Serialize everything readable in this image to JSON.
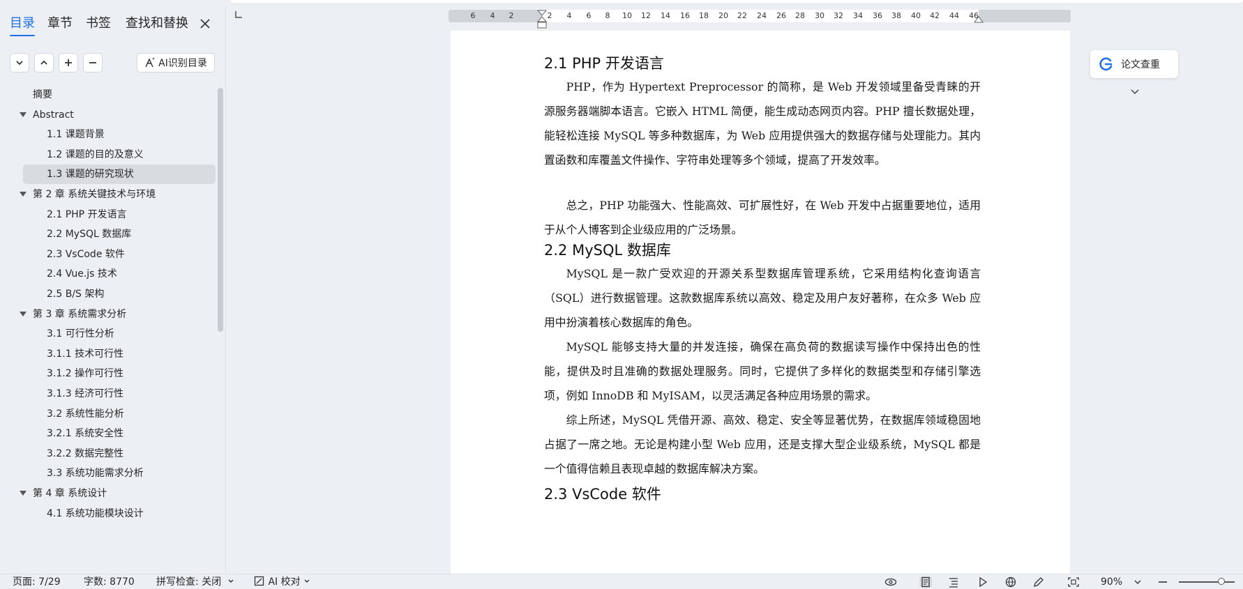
{
  "sidebar": {
    "tabs": [
      "目录",
      "章节",
      "书签",
      "查找和替换"
    ],
    "ai_button": "AI识别目录",
    "toc": [
      {
        "label": "摘要",
        "level": 1,
        "caret": false,
        "selected": false
      },
      {
        "label": "Abstract",
        "level": 1,
        "caret": true,
        "selected": false
      },
      {
        "label": "1.1  课题背景",
        "level": 2,
        "caret": false,
        "selected": false
      },
      {
        "label": "1.2  课题的目的及意义",
        "level": 2,
        "caret": false,
        "selected": false
      },
      {
        "label": "1.3  课题的研究现状",
        "level": 2,
        "caret": false,
        "selected": true
      },
      {
        "label": "第 2 章  系统关键技术与环境",
        "level": 1,
        "caret": true,
        "selected": false
      },
      {
        "label": "2.1 PHP 开发语言",
        "level": 2,
        "caret": false,
        "selected": false
      },
      {
        "label": "2.2 MySQL 数据库",
        "level": 2,
        "caret": false,
        "selected": false
      },
      {
        "label": "2.3 VsCode 软件",
        "level": 2,
        "caret": false,
        "selected": false
      },
      {
        "label": "2.4 Vue.js 技术",
        "level": 2,
        "caret": false,
        "selected": false
      },
      {
        "label": "2.5 B/S 架构",
        "level": 2,
        "caret": false,
        "selected": false
      },
      {
        "label": "第 3 章  系统需求分析",
        "level": 1,
        "caret": true,
        "selected": false
      },
      {
        "label": "3.1 可行性分析",
        "level": 2,
        "caret": false,
        "selected": false
      },
      {
        "label": "3.1.1  技术可行性",
        "level": 2,
        "caret": false,
        "selected": false
      },
      {
        "label": "3.1.2  操作可行性",
        "level": 2,
        "caret": false,
        "selected": false
      },
      {
        "label": "3.1.3  经济可行性",
        "level": 2,
        "caret": false,
        "selected": false
      },
      {
        "label": "3.2 系统性能分析",
        "level": 2,
        "caret": false,
        "selected": false
      },
      {
        "label": "3.2.1  系统安全性",
        "level": 2,
        "caret": false,
        "selected": false
      },
      {
        "label": "3.2.2  数据完整性",
        "level": 2,
        "caret": false,
        "selected": false
      },
      {
        "label": "3.3  系统功能需求分析",
        "level": 2,
        "caret": false,
        "selected": false
      },
      {
        "label": "第 4 章  系统设计",
        "level": 1,
        "caret": true,
        "selected": false
      },
      {
        "label": "4.1 系统功能模块设计",
        "level": 2,
        "caret": false,
        "selected": false
      }
    ]
  },
  "ruler": {
    "ticks": [
      "6",
      "4",
      "2",
      "",
      "2",
      "4",
      "6",
      "8",
      "10",
      "12",
      "14",
      "16",
      "18",
      "20",
      "22",
      "24",
      "26",
      "28",
      "30",
      "32",
      "34",
      "36",
      "38",
      "40",
      "42",
      "44",
      "46"
    ]
  },
  "document": {
    "h_21": "2.1 PHP 开发语言",
    "p_21a": "PHP，作为 Hypertext Preprocessor 的简称，是 Web 开发领域里备受青睐的开源服务器端脚本语言。它嵌入 HTML 简便，能生成动态网页内容。PHP 擅长数据处理，能轻松连接 MySQL 等多种数据库，为 Web 应用提供强大的数据存储与处理能力。其内置函数和库覆盖文件操作、字符串处理等多个领域，提高了开发效率。",
    "p_21b": "总之，PHP 功能强大、性能高效、可扩展性好，在 Web 开发中占据重要地位，适用于从个人博客到企业级应用的广泛场景。",
    "h_22": "2.2 MySQL 数据库",
    "p_22a": "MySQL 是一款广受欢迎的开源关系型数据库管理系统，它采用结构化查询语言（SQL）进行数据管理。这款数据库系统以高效、稳定及用户友好著称，在众多 Web 应用中扮演着核心数据库的角色。",
    "p_22b": "MySQL 能够支持大量的并发连接，确保在高负荷的数据读写操作中保持出色的性能，提供及时且准确的数据处理服务。同时，它提供了多样化的数据类型和存储引擎选项，例如 InnoDB 和 MyISAM，以灵活满足各种应用场景的需求。",
    "p_22c": "综上所述，MySQL 凭借开源、高效、稳定、安全等显著优势，在数据库领域稳固地占据了一席之地。无论是构建小型 Web 应用，还是支撑大型企业级系统，MySQL 都是一个值得信赖且表现卓越的数据库解决方案。",
    "h_23": "2.3 VsCode 软件"
  },
  "right_tool": {
    "label": "论文查重"
  },
  "status": {
    "page": "页面: 7/29",
    "words": "字数: 8770",
    "spell": "拼写检查: 关闭",
    "ai_check": "AI 校对",
    "zoom": "90%"
  },
  "colors": {
    "accent": "#1f6fe5",
    "selected_row": "#d8dbe0",
    "background": "#eceff3"
  }
}
